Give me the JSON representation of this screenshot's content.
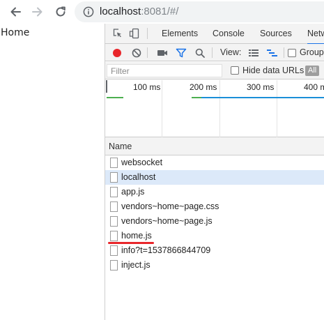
{
  "browser": {
    "url_host": "localhost",
    "url_rest": ":8081/#/",
    "icons": [
      "back-arrow-icon",
      "forward-arrow-icon",
      "reload-icon",
      "info-icon"
    ]
  },
  "page": {
    "content_text": "Home"
  },
  "devtools": {
    "tabs": [
      {
        "label": "Elements",
        "active": false
      },
      {
        "label": "Console",
        "active": false
      },
      {
        "label": "Sources",
        "active": false
      },
      {
        "label": "Netw",
        "active": true
      }
    ],
    "controls": {
      "view_label": "View:",
      "group_label": "Group"
    },
    "filter": {
      "placeholder": "Filter",
      "hide_data_urls_label": "Hide data URLs",
      "all_label": "All"
    },
    "timeline": {
      "ticks": [
        "100 ms",
        "200 ms",
        "300 ms",
        "400 m"
      ]
    },
    "name_column_header": "Name",
    "requests": [
      {
        "name": "websocket",
        "selected": false,
        "underlined": false
      },
      {
        "name": "localhost",
        "selected": true,
        "underlined": false
      },
      {
        "name": "app.js",
        "selected": false,
        "underlined": false
      },
      {
        "name": "vendors~home~page.css",
        "selected": false,
        "underlined": false
      },
      {
        "name": "vendors~home~page.js",
        "selected": false,
        "underlined": false
      },
      {
        "name": "home.js",
        "selected": false,
        "underlined": true
      },
      {
        "name": "info?t=1537866844709",
        "selected": false,
        "underlined": false
      },
      {
        "name": "inject.js",
        "selected": false,
        "underlined": false
      }
    ],
    "colors": {
      "accent": "#1a73e8",
      "record": "#e8262b",
      "selected_row": "#dce9f9",
      "annotation": "#e8262b"
    }
  }
}
